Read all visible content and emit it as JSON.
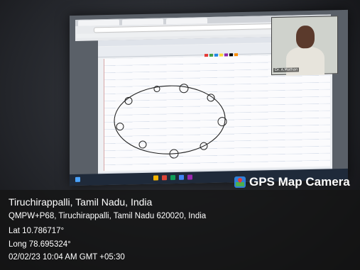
{
  "video_tile": {
    "name_label": "Dr. A.Mathan"
  },
  "watermark": {
    "brand_label": "GPS Map Camera",
    "brand_icon": "map-pin-icon"
  },
  "location": {
    "city": "Tiruchirappalli, Tamil Nadu, India",
    "address": "QMPW+P68, Tiruchirappalli, Tamil Nadu 620020, India",
    "latitude": "Lat 10.786717°",
    "longitude": "Long 78.695324°",
    "timestamp": "02/02/23 10:04 AM GMT +05:30"
  }
}
